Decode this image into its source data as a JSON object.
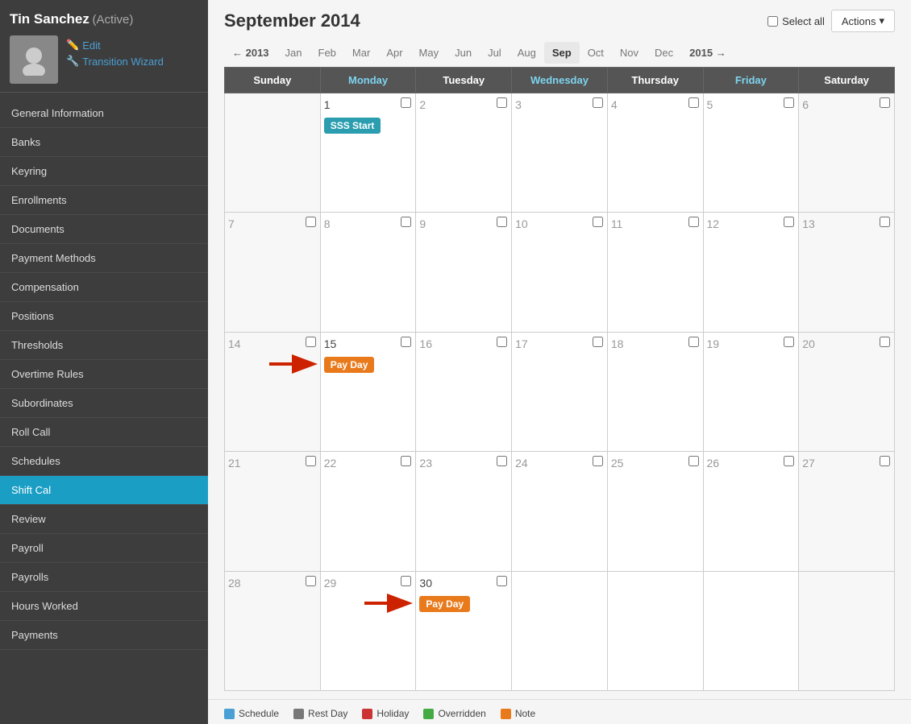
{
  "user": {
    "name": "Tin Sanchez",
    "status": "(Active)",
    "edit_label": "Edit",
    "transition_label": "Transition Wizard"
  },
  "sidebar": {
    "items": [
      {
        "label": "General Information",
        "active": false
      },
      {
        "label": "Banks",
        "active": false
      },
      {
        "label": "Keyring",
        "active": false
      },
      {
        "label": "Enrollments",
        "active": false
      },
      {
        "label": "Documents",
        "active": false
      },
      {
        "label": "Payment Methods",
        "active": false
      },
      {
        "label": "Compensation",
        "active": false
      },
      {
        "label": "Positions",
        "active": false
      },
      {
        "label": "Thresholds",
        "active": false
      },
      {
        "label": "Overtime Rules",
        "active": false
      },
      {
        "label": "Subordinates",
        "active": false
      },
      {
        "label": "Roll Call",
        "active": false
      },
      {
        "label": "Schedules",
        "active": false
      },
      {
        "label": "Shift Cal",
        "active": true
      },
      {
        "label": "Review",
        "active": false
      },
      {
        "label": "Payroll",
        "active": false
      },
      {
        "label": "Payrolls",
        "active": false
      },
      {
        "label": "Hours Worked",
        "active": false
      },
      {
        "label": "Payments",
        "active": false
      }
    ]
  },
  "header": {
    "title": "September 2014",
    "select_all_label": "Select all",
    "actions_label": "Actions"
  },
  "month_nav": {
    "back_year": "← 2013",
    "months": [
      "Jan",
      "Feb",
      "Mar",
      "Apr",
      "May",
      "Jun",
      "Jul",
      "Aug",
      "Sep",
      "Oct",
      "Nov",
      "Dec"
    ],
    "forward_year": "2015 →",
    "current_month": "Sep"
  },
  "calendar": {
    "headers": [
      "Sunday",
      "Monday",
      "Tuesday",
      "Wednesday",
      "Thursday",
      "Friday",
      "Saturday"
    ],
    "rows": [
      [
        {
          "day": "",
          "weekend": true
        },
        {
          "day": "1",
          "event": "SSS Start",
          "event_type": "sss"
        },
        {
          "day": "2"
        },
        {
          "day": "3"
        },
        {
          "day": "4"
        },
        {
          "day": "5"
        },
        {
          "day": "6",
          "weekend": true
        }
      ],
      [
        {
          "day": "7",
          "weekend": true
        },
        {
          "day": "8"
        },
        {
          "day": "9"
        },
        {
          "day": "10"
        },
        {
          "day": "11"
        },
        {
          "day": "12"
        },
        {
          "day": "13",
          "weekend": true
        }
      ],
      [
        {
          "day": "14",
          "weekend": true
        },
        {
          "day": "15",
          "event": "Pay Day",
          "event_type": "payday",
          "arrow": true
        },
        {
          "day": "16"
        },
        {
          "day": "17"
        },
        {
          "day": "18"
        },
        {
          "day": "19"
        },
        {
          "day": "20",
          "weekend": true
        }
      ],
      [
        {
          "day": "21",
          "weekend": true
        },
        {
          "day": "22"
        },
        {
          "day": "23"
        },
        {
          "day": "24"
        },
        {
          "day": "25"
        },
        {
          "day": "26"
        },
        {
          "day": "27",
          "weekend": true
        }
      ],
      [
        {
          "day": "28",
          "weekend": true
        },
        {
          "day": "29"
        },
        {
          "day": "30",
          "event": "Pay Day",
          "event_type": "payday",
          "arrow": true
        },
        {
          "day": ""
        },
        {
          "day": ""
        },
        {
          "day": ""
        },
        {
          "day": "",
          "weekend": true
        }
      ]
    ]
  },
  "legend": [
    {
      "label": "Schedule",
      "color": "#4a9fd4"
    },
    {
      "label": "Rest Day",
      "color": "#777"
    },
    {
      "label": "Holiday",
      "color": "#cc3333"
    },
    {
      "label": "Overridden",
      "color": "#44aa44"
    },
    {
      "label": "Note",
      "color": "#e87a1c"
    }
  ]
}
